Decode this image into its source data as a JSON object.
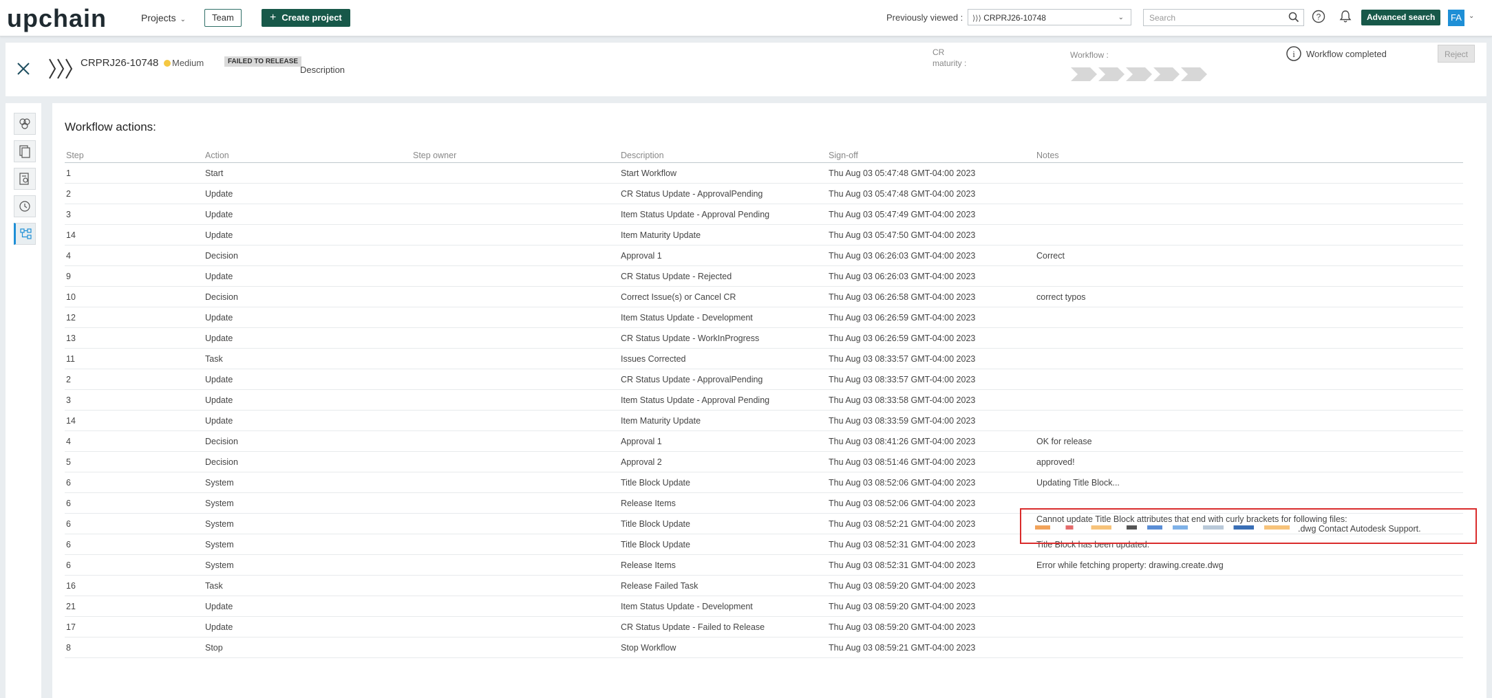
{
  "topbar": {
    "logo": "upchain",
    "projects_label": "Projects",
    "team_label": "Team",
    "create_project_label": "Create project",
    "previously_viewed_label": "Previously viewed :",
    "previously_viewed_value": "CRPRJ26-10748",
    "search_placeholder": "Search",
    "advanced_search_label": "Advanced search",
    "avatar_initials": "FA"
  },
  "header": {
    "cr_id": "CRPRJ26-10748",
    "priority": "Medium",
    "status": "FAILED TO RELEASE",
    "description_label": "Description",
    "maturity_label": "CR maturity :",
    "workflow_label": "Workflow :",
    "workflow_status": "Workflow completed",
    "reject_label": "Reject"
  },
  "colors": {
    "brand": "#175849",
    "accent": "#1e8fd6",
    "priority_medium": "#f5c842",
    "highlight": "#d92b2b"
  },
  "main": {
    "title": "Workflow actions:",
    "columns": [
      "Step",
      "Action",
      "Step owner",
      "Description",
      "Sign-off",
      "Notes"
    ],
    "rows": [
      {
        "step": "1",
        "action": "Start",
        "owner": "",
        "description": "Start Workflow",
        "signoff": "Thu Aug 03 05:47:48 GMT-04:00 2023",
        "notes": ""
      },
      {
        "step": "2",
        "action": "Update",
        "owner": "",
        "description": "CR Status Update - ApprovalPending",
        "signoff": "Thu Aug 03 05:47:48 GMT-04:00 2023",
        "notes": ""
      },
      {
        "step": "3",
        "action": "Update",
        "owner": "",
        "description": "Item Status Update - Approval Pending",
        "signoff": "Thu Aug 03 05:47:49 GMT-04:00 2023",
        "notes": ""
      },
      {
        "step": "14",
        "action": "Update",
        "owner": "",
        "description": "Item Maturity Update",
        "signoff": "Thu Aug 03 05:47:50 GMT-04:00 2023",
        "notes": ""
      },
      {
        "step": "4",
        "action": "Decision",
        "owner": "",
        "description": "Approval 1",
        "signoff": "Thu Aug 03 06:26:03 GMT-04:00 2023",
        "notes": "Correct"
      },
      {
        "step": "9",
        "action": "Update",
        "owner": "",
        "description": "CR Status Update - Rejected",
        "signoff": "Thu Aug 03 06:26:03 GMT-04:00 2023",
        "notes": ""
      },
      {
        "step": "10",
        "action": "Decision",
        "owner": "",
        "description": "Correct Issue(s) or Cancel CR",
        "signoff": "Thu Aug 03 06:26:58 GMT-04:00 2023",
        "notes": "correct typos"
      },
      {
        "step": "12",
        "action": "Update",
        "owner": "",
        "description": "Item Status Update - Development",
        "signoff": "Thu Aug 03 06:26:59 GMT-04:00 2023",
        "notes": ""
      },
      {
        "step": "13",
        "action": "Update",
        "owner": "",
        "description": "CR Status Update - WorkInProgress",
        "signoff": "Thu Aug 03 06:26:59 GMT-04:00 2023",
        "notes": ""
      },
      {
        "step": "11",
        "action": "Task",
        "owner": "",
        "description": "Issues Corrected",
        "signoff": "Thu Aug 03 08:33:57 GMT-04:00 2023",
        "notes": ""
      },
      {
        "step": "2",
        "action": "Update",
        "owner": "",
        "description": "CR Status Update - ApprovalPending",
        "signoff": "Thu Aug 03 08:33:57 GMT-04:00 2023",
        "notes": ""
      },
      {
        "step": "3",
        "action": "Update",
        "owner": "",
        "description": "Item Status Update - Approval Pending",
        "signoff": "Thu Aug 03 08:33:58 GMT-04:00 2023",
        "notes": ""
      },
      {
        "step": "14",
        "action": "Update",
        "owner": "",
        "description": "Item Maturity Update",
        "signoff": "Thu Aug 03 08:33:59 GMT-04:00 2023",
        "notes": ""
      },
      {
        "step": "4",
        "action": "Decision",
        "owner": "",
        "description": "Approval 1",
        "signoff": "Thu Aug 03 08:41:26 GMT-04:00 2023",
        "notes": "OK for release"
      },
      {
        "step": "5",
        "action": "Decision",
        "owner": "",
        "description": "Approval 2",
        "signoff": "Thu Aug 03 08:51:46 GMT-04:00 2023",
        "notes": "approved!"
      },
      {
        "step": "6",
        "action": "System",
        "owner": "",
        "description": "Title Block Update",
        "signoff": "Thu Aug 03 08:52:06 GMT-04:00 2023",
        "notes": "Updating Title Block..."
      },
      {
        "step": "6",
        "action": "System",
        "owner": "",
        "description": "Release Items",
        "signoff": "Thu Aug 03 08:52:06 GMT-04:00 2023",
        "notes": ""
      },
      {
        "step": "6",
        "action": "System",
        "owner": "",
        "description": "Title Block Update",
        "signoff": "Thu Aug 03 08:52:21 GMT-04:00 2023",
        "notes": "Cannot update Title Block attributes that end with curly brackets for following files:"
      },
      {
        "step": "6",
        "action": "System",
        "owner": "",
        "description": "Title Block Update",
        "signoff": "Thu Aug 03 08:52:31 GMT-04:00 2023",
        "notes": "Title Block has been updated."
      },
      {
        "step": "6",
        "action": "System",
        "owner": "",
        "description": "Release Items",
        "signoff": "Thu Aug 03 08:52:31 GMT-04:00 2023",
        "notes": "Error while fetching property: drawing.create.dwg"
      },
      {
        "step": "16",
        "action": "Task",
        "owner": "",
        "description": "Release Failed Task",
        "signoff": "Thu Aug 03 08:59:20 GMT-04:00 2023",
        "notes": ""
      },
      {
        "step": "21",
        "action": "Update",
        "owner": "",
        "description": "Item Status Update - Development",
        "signoff": "Thu Aug 03 08:59:20 GMT-04:00 2023",
        "notes": ""
      },
      {
        "step": "17",
        "action": "Update",
        "owner": "",
        "description": "CR Status Update - Failed to Release",
        "signoff": "Thu Aug 03 08:59:20 GMT-04:00 2023",
        "notes": ""
      },
      {
        "step": "8",
        "action": "Stop",
        "owner": "",
        "description": "Stop Workflow",
        "signoff": "Thu Aug 03 08:59:21 GMT-04:00 2023",
        "notes": ""
      }
    ],
    "error_note_tail": ".dwg Contact Autodesk Support."
  }
}
